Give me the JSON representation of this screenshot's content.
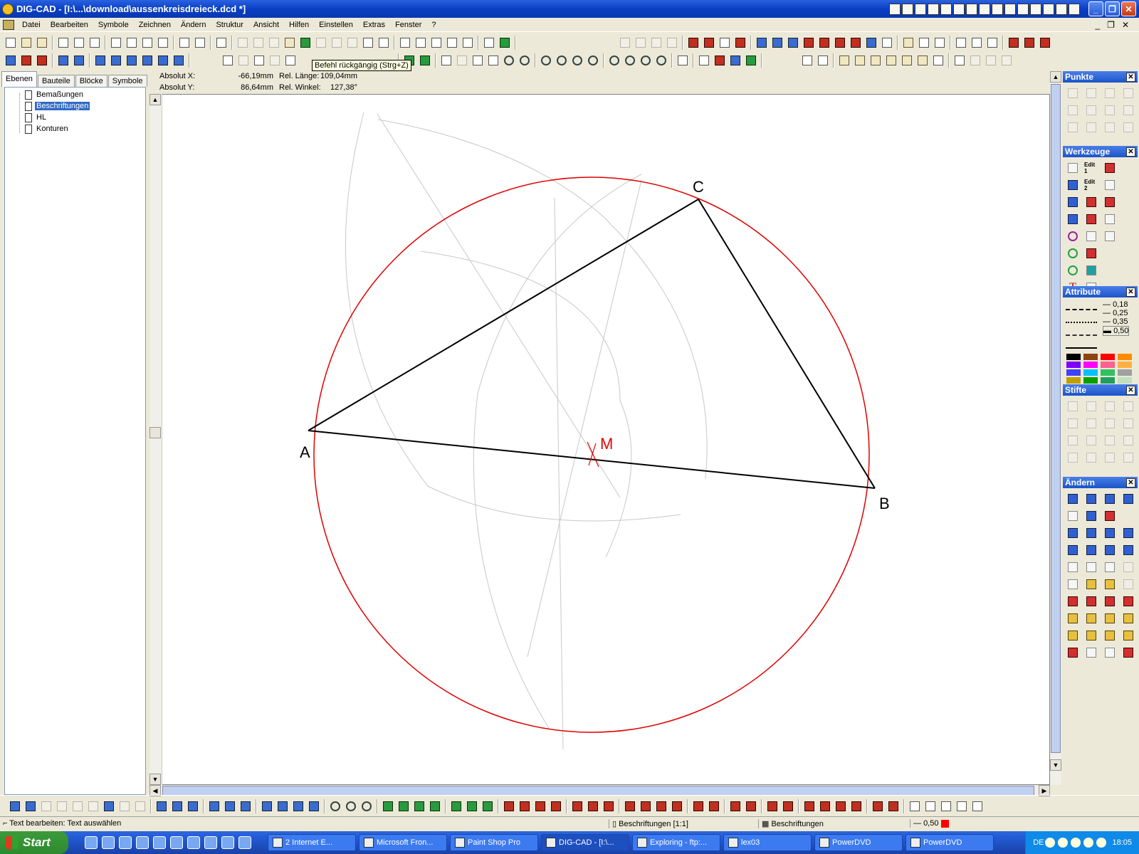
{
  "window": {
    "title": "DIG-CAD - [I:\\...\\download\\aussenkreisdreieck.dcd *]"
  },
  "menu": [
    "Datei",
    "Bearbeiten",
    "Symbole",
    "Zeichnen",
    "Ändern",
    "Struktur",
    "Ansicht",
    "Hilfen",
    "Einstellen",
    "Extras",
    "Fenster",
    "?"
  ],
  "tooltip": "Befehl rückgängig (Strg+Z)",
  "tabs": [
    "Ebenen",
    "Bauteile",
    "Blöcke",
    "Symbole"
  ],
  "layers": [
    "Bemaßungen",
    "Beschriftungen",
    "HL",
    "Konturen"
  ],
  "coords": {
    "abs_x_label": "Absolut X:",
    "abs_x": "-66,19mm",
    "abs_y_label": "Absolut Y:",
    "abs_y": "86,64mm",
    "rel_len_label": "Rel. Länge:",
    "rel_len": "109,04mm",
    "rel_angle_label": "Rel. Winkel:",
    "rel_angle": "127,38°"
  },
  "drawing": {
    "labels": {
      "A": "A",
      "B": "B",
      "C": "C",
      "M": "M"
    },
    "colors": {
      "circle": "#e00000",
      "triangle": "#000000",
      "construction": "#c8c8c8",
      "midpoint": "#e00000"
    }
  },
  "palettes": {
    "punkte": "Punkte",
    "werkzeuge": "Werkzeuge",
    "werkzeuge_icons": [
      "Edit 1",
      "Edit 2"
    ],
    "attribute": "Attribute",
    "linewidths": [
      "0,18",
      "0,25",
      "0,35",
      "0,50"
    ],
    "stifte": "Stifte",
    "aendern": "Ändern",
    "swatches": [
      "#000000",
      "#8b4513",
      "#ff0000",
      "#ff8c00",
      "#8000ff",
      "#ff00ff",
      "#ff6090",
      "#ffb040",
      "#4040ff",
      "#00c0ff",
      "#30c060",
      "#a0a0a0",
      "#c0a000",
      "#00a000",
      "#20a060",
      "#c0e0c0"
    ]
  },
  "status": {
    "left": "Text bearbeiten: Text auswählen",
    "layer": "Beschriftungen [1:1]",
    "layer2": "Beschriftungen",
    "pen": "0,50",
    "pen_color": "#ff0000"
  },
  "taskbar": {
    "start": "Start",
    "tasks": [
      "2 Internet E...",
      "Microsoft Fron...",
      "Paint Shop Pro",
      "DIG-CAD - [I:\\...",
      "Exploring - ftp:...",
      "lex03",
      "PowerDVD",
      "PowerDVD"
    ],
    "lang": "DE",
    "time": "18:05"
  }
}
